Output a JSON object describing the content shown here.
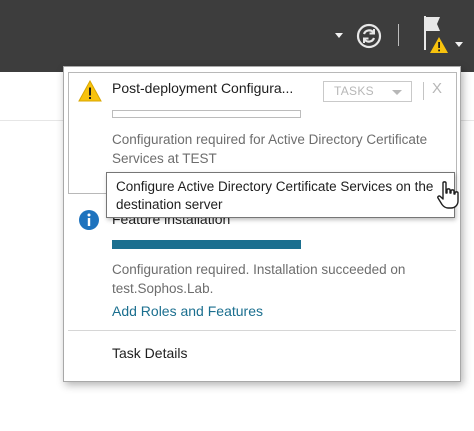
{
  "header": {
    "icons": [
      "dropdown-caret-icon",
      "refresh-icon",
      "notification-flag-icon"
    ]
  },
  "notifications": [
    {
      "title": "Post-deployment Configura...",
      "icon": "warning-icon",
      "description": "Configuration required for Active Directory Certificate Services at TEST",
      "progress": 0
    },
    {
      "title": "Feature installation",
      "icon": "info-icon",
      "description": "Configuration required. Installation succeeded on test.Sophos.Lab.",
      "progress": 1.0,
      "link": "Add Roles and Features"
    }
  ],
  "tasks_button": {
    "label": "TASKS"
  },
  "close_label": "X",
  "tooltip": {
    "text": "Configure Active Directory Certificate Services on the destination server"
  },
  "footer": {
    "task_details": "Task Details"
  },
  "colors": {
    "topbar": "#3d3d3d",
    "accent": "#1b6f8f",
    "warning": "#f7c20d",
    "info": "#1e73be"
  }
}
